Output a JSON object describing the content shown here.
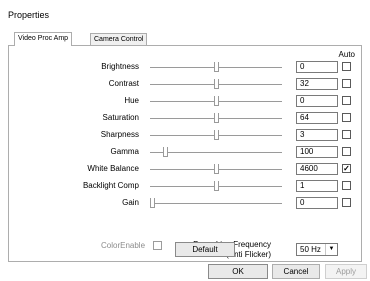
{
  "window": {
    "title": "Properties"
  },
  "tabs": [
    {
      "label": "Video Proc Amp",
      "active": true
    },
    {
      "label": "Camera Control",
      "active": false
    }
  ],
  "auto_header": "Auto",
  "settings": [
    {
      "label": "Brightness",
      "value": "0",
      "level": 0.5,
      "auto": false
    },
    {
      "label": "Contrast",
      "value": "32",
      "level": 0.5,
      "auto": false
    },
    {
      "label": "Hue",
      "value": "0",
      "level": 0.5,
      "auto": false
    },
    {
      "label": "Saturation",
      "value": "64",
      "level": 0.5,
      "auto": false
    },
    {
      "label": "Sharpness",
      "value": "3",
      "level": 0.5,
      "auto": false
    },
    {
      "label": "Gamma",
      "value": "100",
      "level": 0.1,
      "auto": false
    },
    {
      "label": "White Balance",
      "value": "4600",
      "level": 0.5,
      "auto": true
    },
    {
      "label": "Backlight Comp",
      "value": "1",
      "level": 0.5,
      "auto": false
    },
    {
      "label": "Gain",
      "value": "0",
      "level": 0.0,
      "auto": false
    }
  ],
  "color_enable": {
    "label": "ColorEnable",
    "checked": false
  },
  "powerline": {
    "label_line1": "PowerLine Frequency",
    "label_line2": "(Anti Flicker)",
    "selected": "50 Hz"
  },
  "buttons": {
    "default": "Default",
    "ok": "OK",
    "cancel": "Cancel",
    "apply": "Apply"
  },
  "colors": {
    "checkmark": "#000000",
    "disabled_text": "#8c8c8c"
  }
}
